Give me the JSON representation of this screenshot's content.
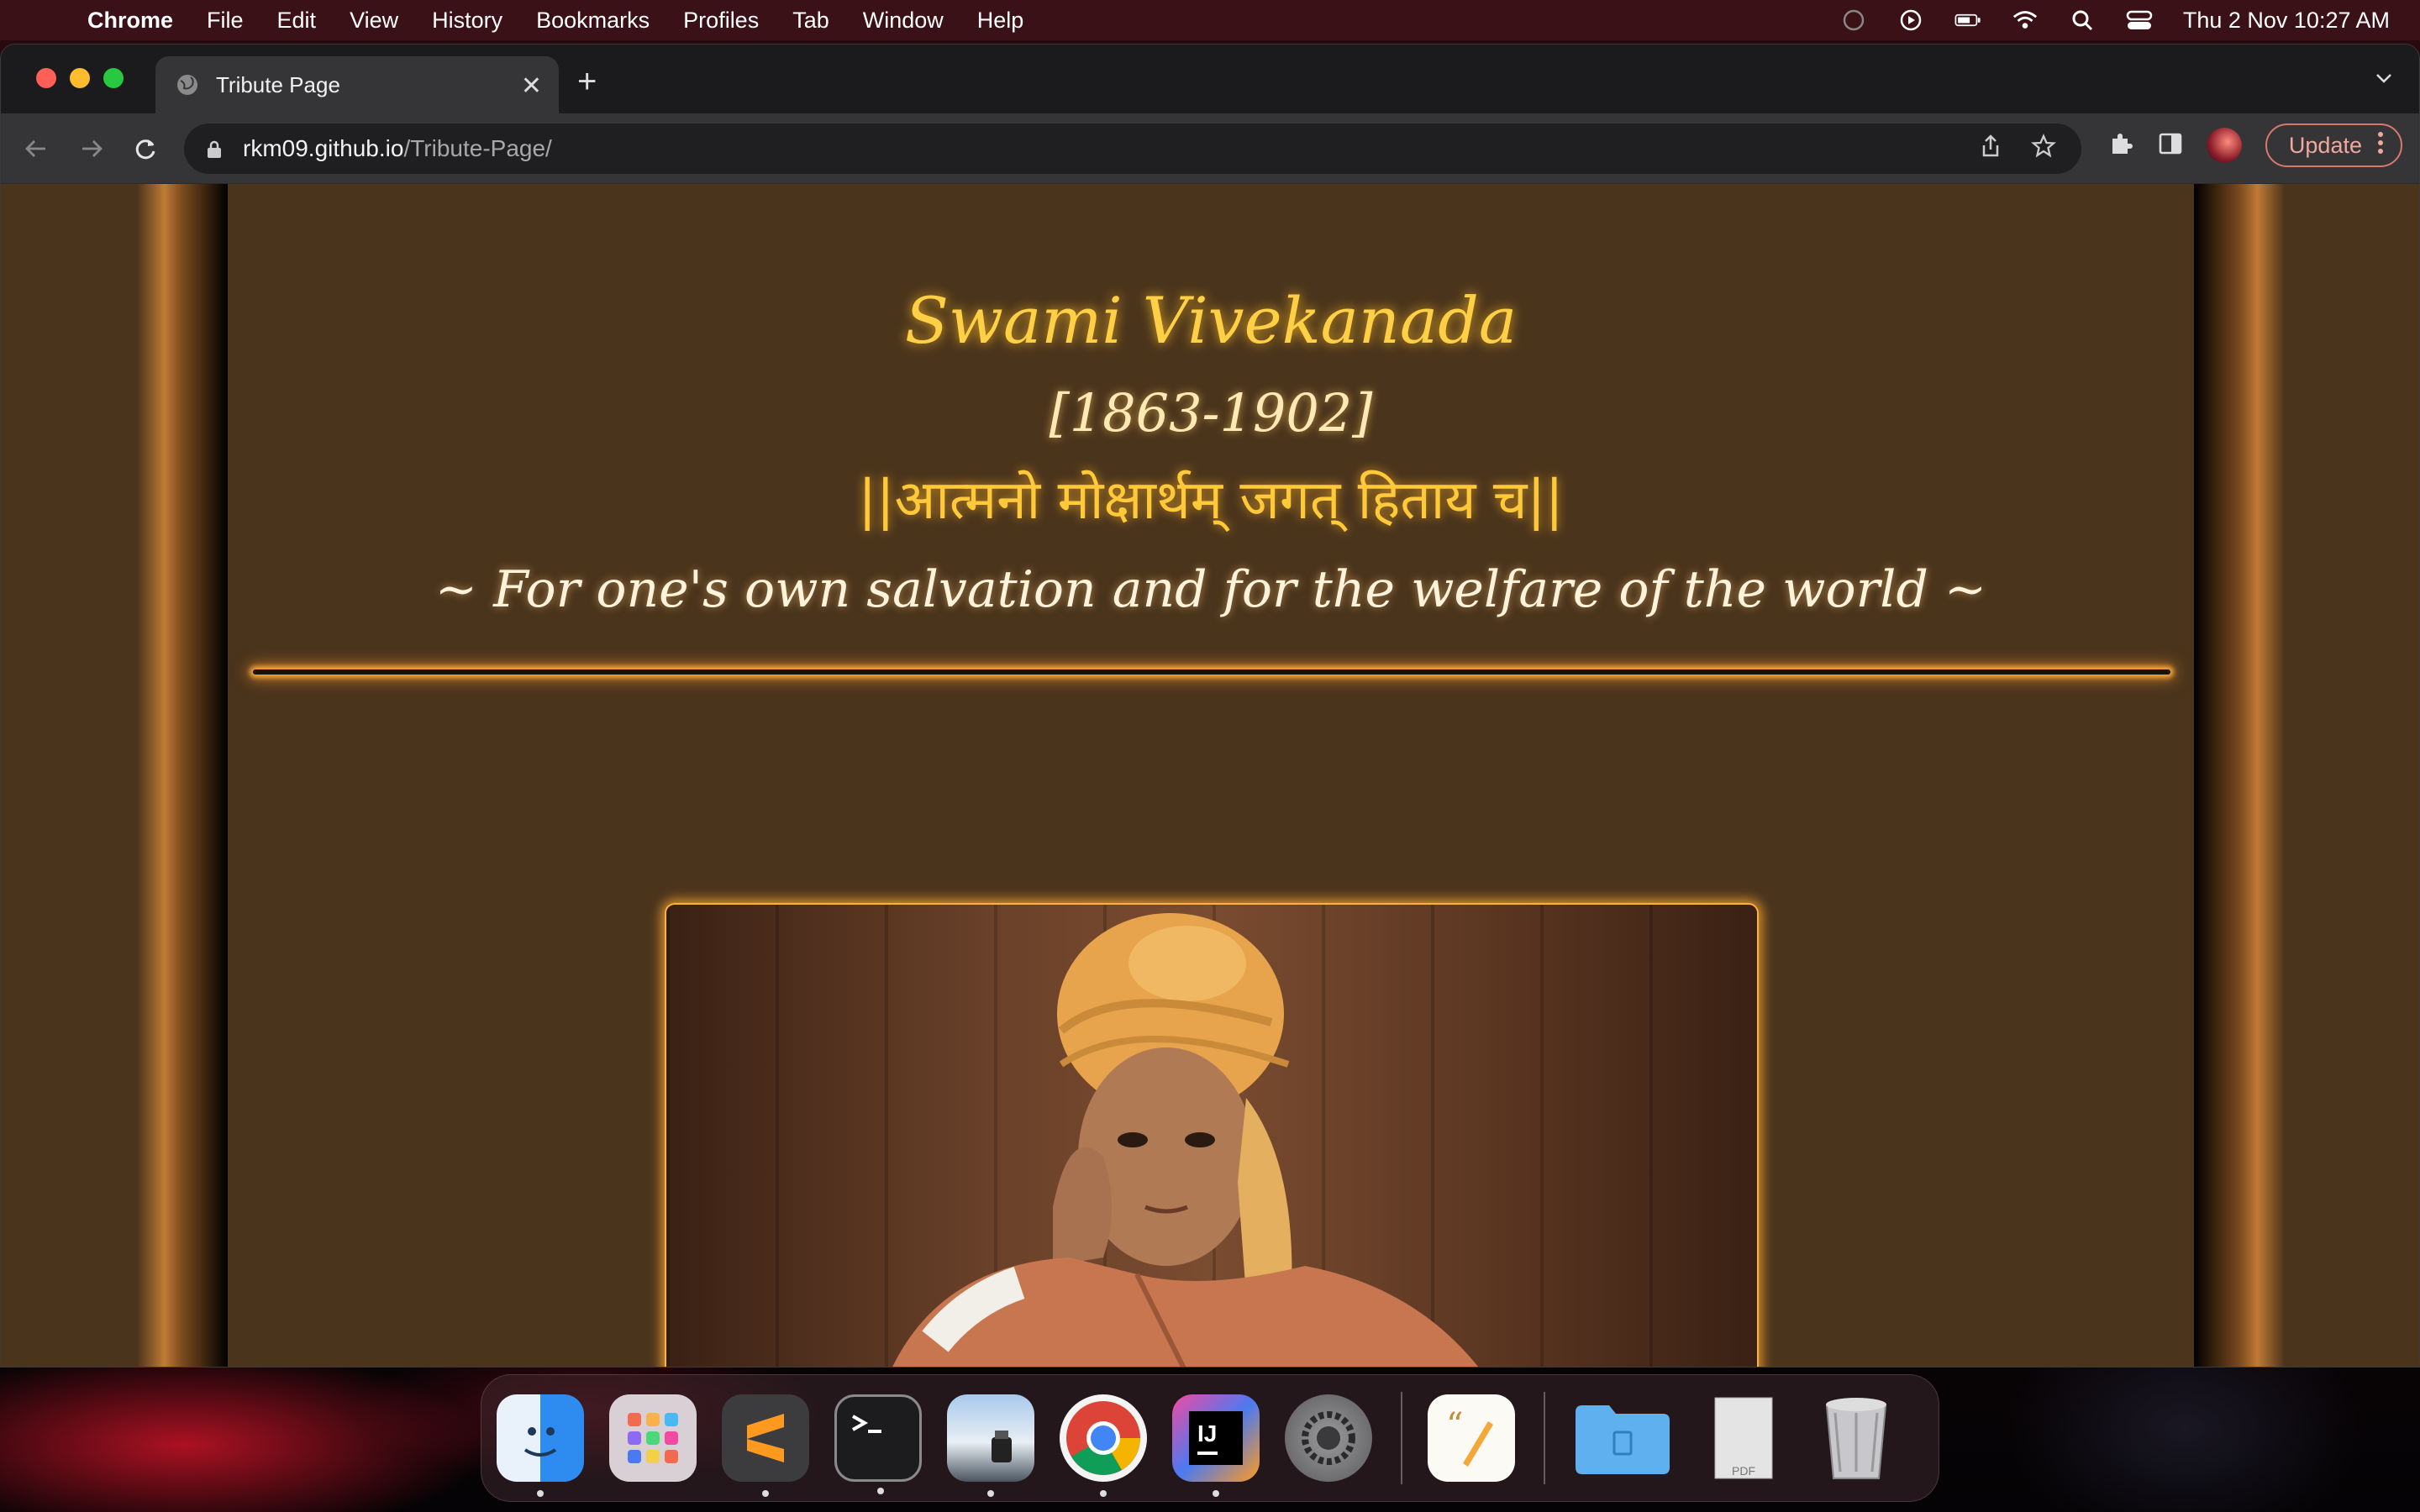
{
  "menubar": {
    "app_name": "Chrome",
    "items": [
      "File",
      "Edit",
      "View",
      "History",
      "Bookmarks",
      "Profiles",
      "Tab",
      "Window",
      "Help"
    ],
    "datetime": "Thu 2 Nov  10:27 AM"
  },
  "browser": {
    "tab_title": "Tribute Page",
    "url_host": "rkm09.github.io",
    "url_path": "/Tribute-Page/",
    "update_label": "Update"
  },
  "page": {
    "title": "Swami Vivekanada",
    "years": "[1863-1902]",
    "sanskrit": "||आत्मनो मोक्षार्थम् जगत् हिताय च||",
    "motto": "~ For one's own salvation and for the welfare of the world ~",
    "colors": {
      "background": "#4a341c",
      "title": "#ffd045",
      "glow": "#f4a43c"
    }
  },
  "dock": {
    "apps": [
      "finder-icon",
      "launchpad-icon",
      "sublime-text-icon",
      "terminal-icon",
      "preview-icon",
      "chrome-icon",
      "intellij-icon",
      "system-settings-icon",
      "pages-icon",
      "folder-icon",
      "pdf-icon",
      "trash-icon"
    ]
  }
}
